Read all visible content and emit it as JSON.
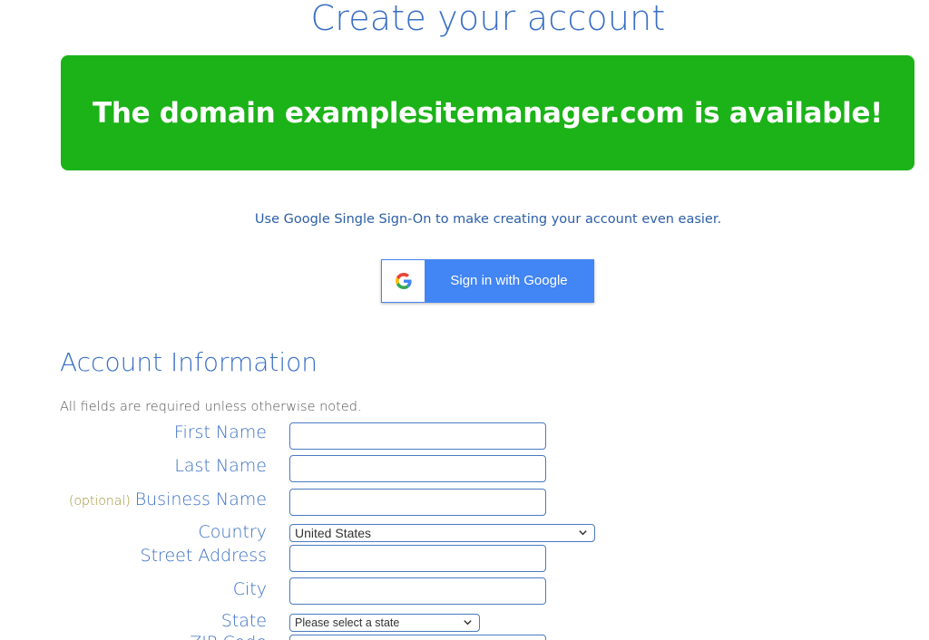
{
  "page": {
    "title": "Create your account",
    "banner": "The domain examplesitemanager.com is available!",
    "sso_text": "Use Google Single Sign-On to make creating your account even easier.",
    "google_button": "Sign in with Google"
  },
  "account": {
    "section_title": "Account Information",
    "required_note": "All fields are required unless otherwise noted.",
    "first_name_label": "First Name",
    "last_name_label": "Last Name",
    "optional_tag": "(optional)",
    "business_name_label": "Business Name",
    "country_label": "Country",
    "country_value": "United States",
    "street_label": "Street Address",
    "city_label": "City",
    "state_label": "State",
    "state_value": "Please select a state",
    "zip_label": "ZIP Code"
  },
  "colors": {
    "banner_green": "#1bb318",
    "heading_blue": "#3a6fc4",
    "google_blue": "#4285f4",
    "optional_olive": "#9a8f2e"
  },
  "icons": {
    "google": "google-g-icon",
    "dropdown": "chevron-down-icon"
  }
}
